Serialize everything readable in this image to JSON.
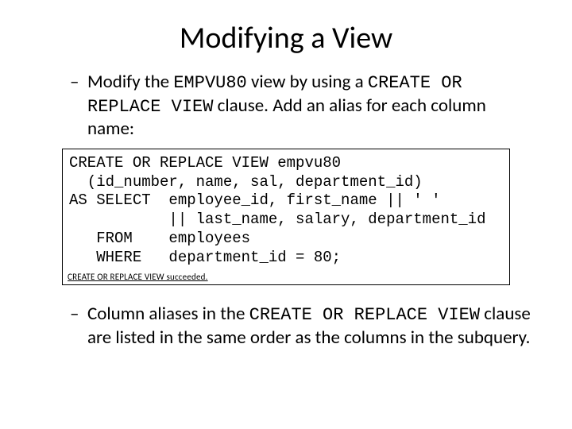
{
  "title": "Modifying a View",
  "bullet1": {
    "dash": "–",
    "pre": "Modify the ",
    "code1": "EMPVU80",
    "mid": " view by using a ",
    "code2": "CREATE OR REPLACE VIEW",
    "post": " clause. Add an alias for each column name:"
  },
  "code": "CREATE OR REPLACE VIEW empvu80\n  (id_number, name, sal, department_id)\nAS SELECT  employee_id, first_name || ' '\n           || last_name, salary, department_id\n   FROM    employees\n   WHERE   department_id = 80;",
  "result": "CREATE OR REPLACE VIEW succeeded.",
  "bullet2": {
    "dash": "–",
    "pre": "Column aliases in the ",
    "code1": "CREATE OR REPLACE VIEW",
    "post": " clause are listed in the same order as the columns in the subquery."
  }
}
